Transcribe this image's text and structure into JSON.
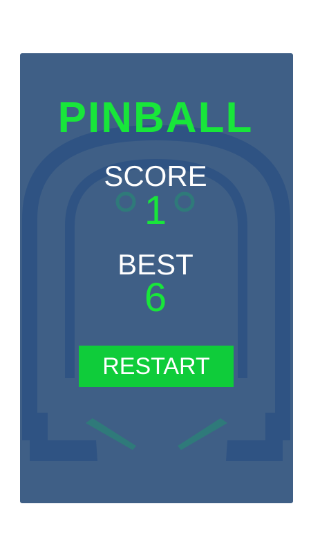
{
  "game": {
    "title": "PINBALL",
    "score_label": "SCORE",
    "score_value": "1",
    "best_label": "BEST",
    "best_value": "6",
    "restart_label": "RESTART"
  },
  "colors": {
    "panel_background": "#3f5f86",
    "board_outline": "#2f5383",
    "flipper": "#2f7a7a",
    "accent_green": "#18e63a",
    "button_green": "#0fcc3a",
    "text_white": "#ffffff"
  }
}
